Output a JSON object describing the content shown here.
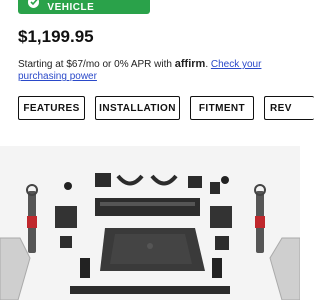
{
  "fits_button": {
    "label": "FITS YOUR VEHICLE"
  },
  "price": "$1,199.95",
  "financing": {
    "prefix": "Starting at $67/mo or 0% APR with",
    "brand": "affirm",
    "period": ".",
    "link": "Check your purchasing power"
  },
  "tabs": [
    {
      "label": "FEATURES"
    },
    {
      "label": "INSTALLATION"
    },
    {
      "label": "FITMENT"
    },
    {
      "label": "REV"
    }
  ],
  "product_image": {
    "alt": "Lift kit components",
    "icon": "lift-kit-image"
  },
  "colors": {
    "green": "#2aa24a",
    "link": "#2a49c9",
    "red_accent": "#c0282d"
  }
}
